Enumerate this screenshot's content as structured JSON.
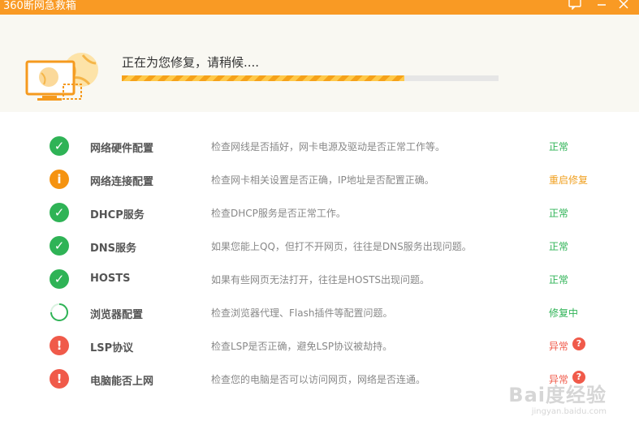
{
  "window": {
    "title": "360断网急救箱",
    "feedback_icon": "feedback-icon",
    "minimize_icon": "minimize-icon",
    "close_icon": "close-icon"
  },
  "header": {
    "status_text": "正在为您修复，请稍候....",
    "progress_fraction": 0.75,
    "illustration_icon": "monitor-globe-icon"
  },
  "colors": {
    "accent": "#f99a24",
    "ok": "#2fb356",
    "info": "#f59311",
    "error": "#f05a4a"
  },
  "checks": [
    {
      "name": "网络硬件配置",
      "desc": "检查网线是否插好，网卡电源及驱动是否正常工作等。",
      "result": "正常",
      "icon": "check-icon",
      "state": "ok"
    },
    {
      "name": "网络连接配置",
      "desc": "检查网卡相关设置是否正确，IP地址是否配置正确。",
      "result": "重启修复",
      "icon": "info-icon",
      "state": "info"
    },
    {
      "name": "DHCP服务",
      "desc": "检查DHCP服务是否正常工作。",
      "result": "正常",
      "icon": "check-icon",
      "state": "ok"
    },
    {
      "name": "DNS服务",
      "desc": "如果您能上QQ，但打不开网页，往往是DNS服务出现问题。",
      "result": "正常",
      "icon": "check-icon",
      "state": "ok"
    },
    {
      "name": "HOSTS",
      "desc": "如果有些网页无法打开，往往是HOSTS出现问题。",
      "result": "正常",
      "icon": "check-icon",
      "state": "ok"
    },
    {
      "name": "浏览器配置",
      "desc": "检查浏览器代理、Flash插件等配置问题。",
      "result": "修复中",
      "icon": "spinner-icon",
      "state": "repairing"
    },
    {
      "name": "LSP协议",
      "desc": "检查LSP是否正确，避免LSP协议被劫持。",
      "result": "异常",
      "icon": "error-icon",
      "state": "error",
      "help": "?"
    },
    {
      "name": "电脑能否上网",
      "desc": "检查您的电脑是否可以访问网页，网络是否连通。",
      "result": "异常",
      "icon": "error-icon",
      "state": "error",
      "help": "?"
    }
  ],
  "watermark": {
    "brand": "Bai度经验",
    "url": "jingyan.baidu.com"
  }
}
